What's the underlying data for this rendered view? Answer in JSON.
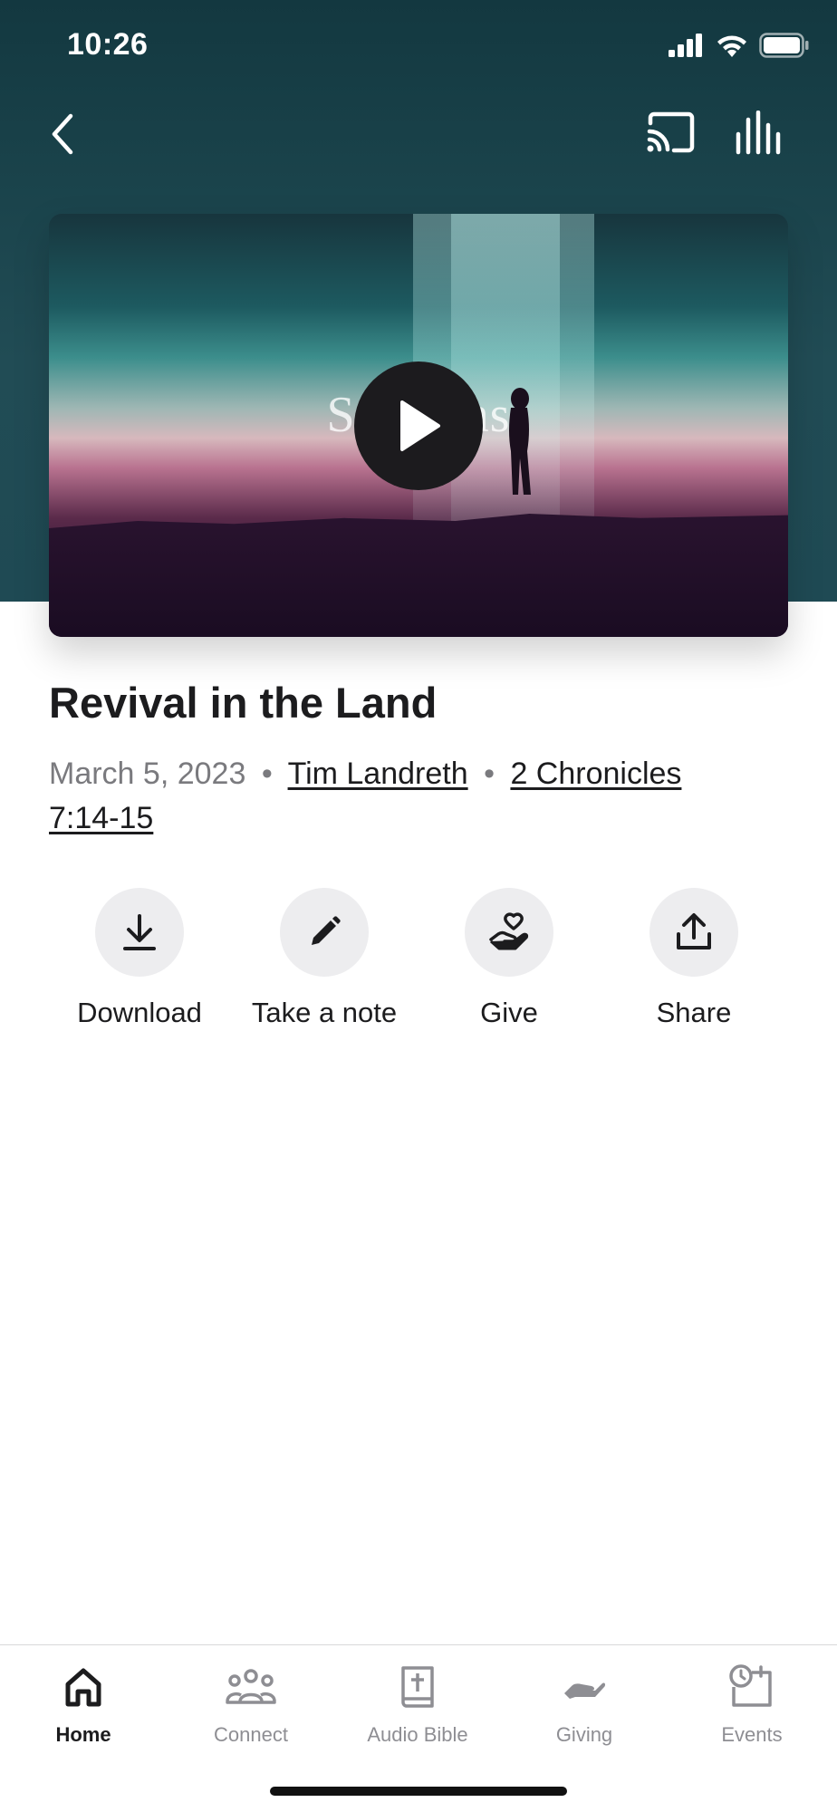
{
  "status_bar": {
    "time": "10:26",
    "icons": [
      "signal-icon",
      "wifi-icon",
      "battery-icon"
    ]
  },
  "top_nav": {
    "icons": [
      "back-chevron-icon",
      "cast-icon",
      "audio-equalizer-icon"
    ]
  },
  "video": {
    "caption": "Sermons",
    "play_icon": "play-icon"
  },
  "sermon": {
    "title": "Revival in the Land",
    "date": "March 5, 2023",
    "separator": "•",
    "speaker": "Tim Landreth",
    "scripture": "2 Chronicles 7:14-15"
  },
  "actions": [
    {
      "label": "Download",
      "icon": "download-icon"
    },
    {
      "label": "Take a note",
      "icon": "pencil-icon"
    },
    {
      "label": "Give",
      "icon": "heart-hand-icon"
    },
    {
      "label": "Share",
      "icon": "share-icon"
    }
  ],
  "tabs": [
    {
      "label": "Home",
      "icon": "home-icon",
      "active": true
    },
    {
      "label": "Connect",
      "icon": "people-icon",
      "active": false
    },
    {
      "label": "Audio Bible",
      "icon": "bible-icon",
      "active": false
    },
    {
      "label": "Giving",
      "icon": "giving-hand-icon",
      "active": false
    },
    {
      "label": "Events",
      "icon": "calendar-clock-icon",
      "active": false
    }
  ],
  "colors": {
    "hero": "#1d454e",
    "text": "#1c1c1e",
    "muted": "#7a7a7e",
    "action_circle": "#ededef",
    "tab_inactive": "#8e8e93"
  }
}
